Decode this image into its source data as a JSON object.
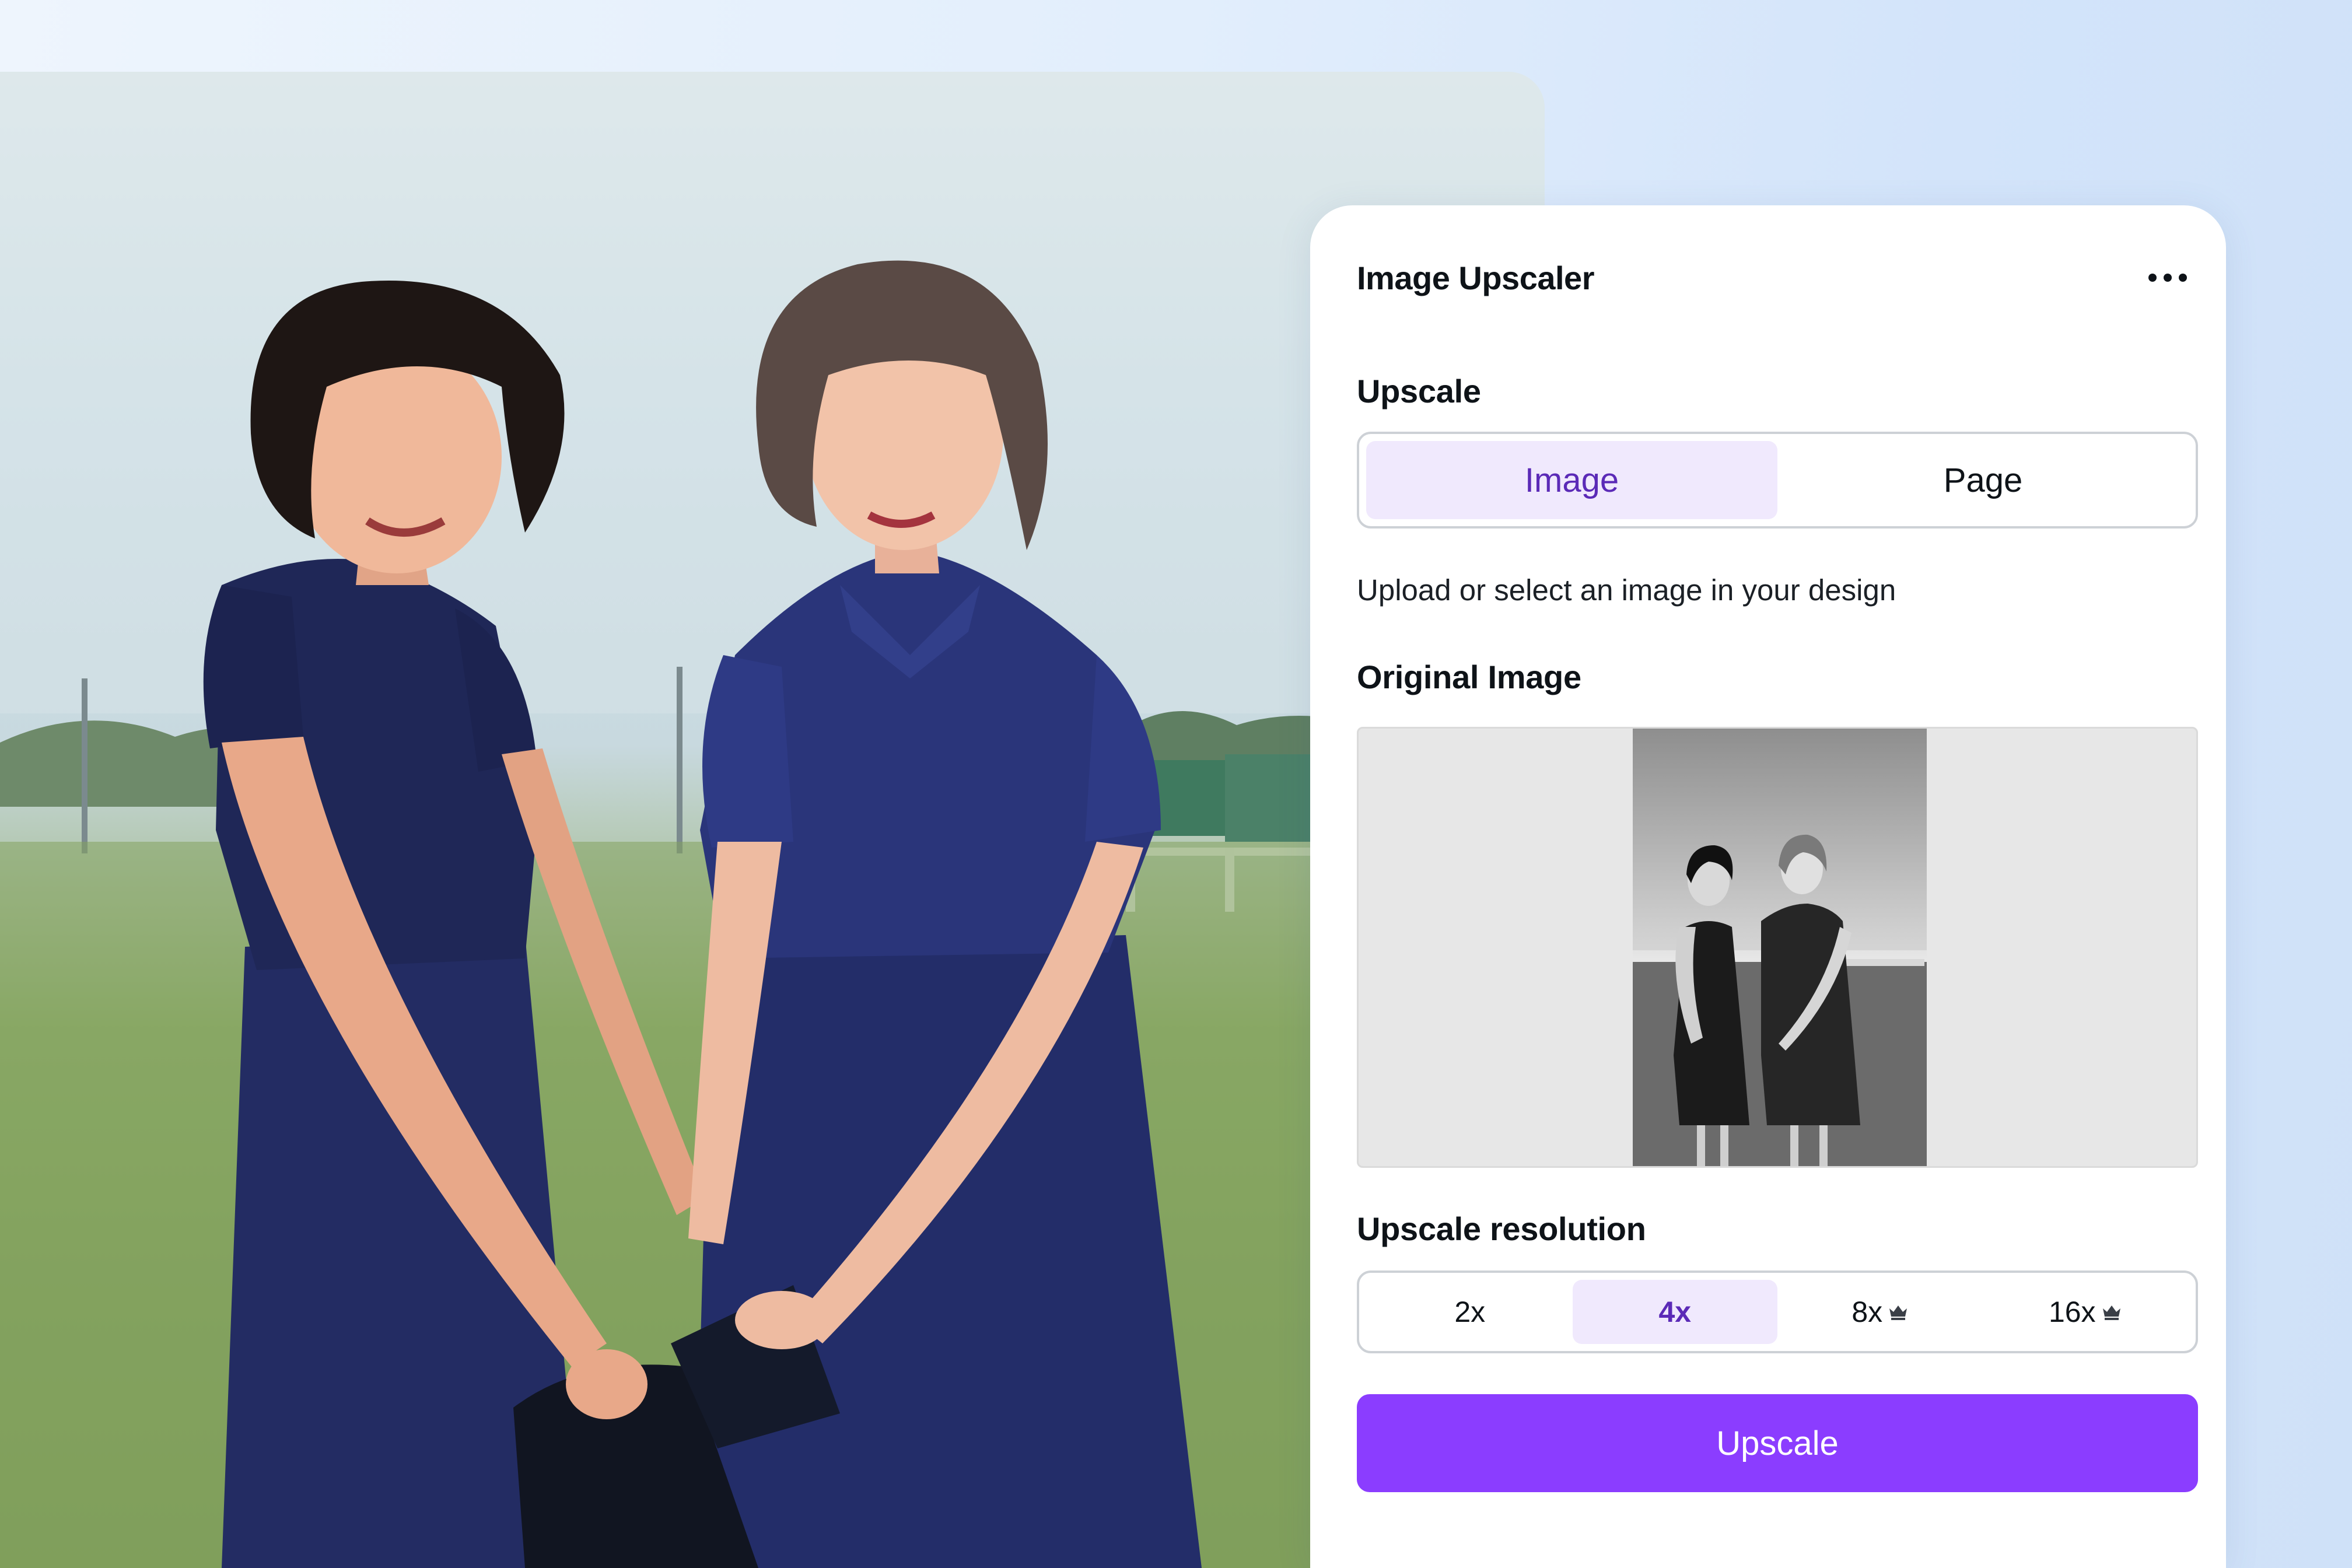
{
  "photo": {
    "alt_semantic": "colorized-photo-two-women"
  },
  "panel": {
    "title": "Image Upscaler",
    "more_icon": "more-horizontal-icon",
    "upscale_label": "Upscale",
    "upscale_options": [
      {
        "label": "Image",
        "selected": true
      },
      {
        "label": "Page",
        "selected": false
      }
    ],
    "hint": "Upload or select an image in your design",
    "original_label": "Original Image",
    "resolution_label": "Upscale resolution",
    "resolution_options": [
      {
        "label": "2x",
        "selected": false,
        "premium": false
      },
      {
        "label": "4x",
        "selected": true,
        "premium": false
      },
      {
        "label": "8x",
        "selected": false,
        "premium": true
      },
      {
        "label": "16x",
        "selected": false,
        "premium": true
      }
    ],
    "premium_icon": "crown-icon",
    "button_label": "Upscale"
  },
  "colors": {
    "accent": "#8b3dff",
    "selected_bg": "#f0e9fd",
    "selected_text": "#5b2ab7"
  }
}
